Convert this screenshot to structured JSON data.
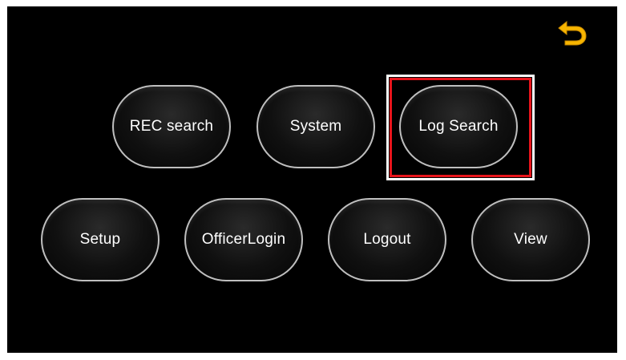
{
  "header": {
    "back_icon": "back-arrow-icon",
    "back_icon_color": "#f7b500"
  },
  "menu": {
    "rec_search": "REC search",
    "system": "System",
    "log_search": "Log Search",
    "setup": "Setup",
    "officer_login": "OfficerLogin",
    "logout": "Logout",
    "view": "View"
  },
  "selection": {
    "selected_item": "Log Search",
    "highlight_color": "#e8141b"
  }
}
